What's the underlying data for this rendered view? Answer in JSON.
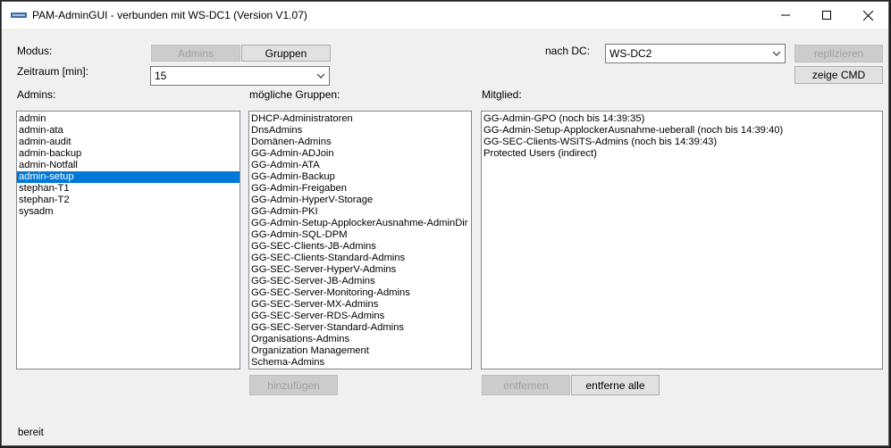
{
  "window": {
    "title": "PAM-AdminGUI - verbunden mit WS-DC1 (Version V1.07)",
    "minimize_icon": "minimize-icon",
    "maximize_icon": "maximize-icon",
    "close_icon": "close-icon"
  },
  "mode": {
    "label": "Modus:",
    "admins_button": "Admins",
    "admins_enabled": false,
    "groups_button": "Gruppen"
  },
  "timerange": {
    "label": "Zeitraum [min]:",
    "value": "15"
  },
  "dc": {
    "label": "nach DC:",
    "value": "WS-DC2",
    "replicate_button": "replizieren",
    "replicate_enabled": false,
    "show_cmd_button": "zeige CMD"
  },
  "admins": {
    "label": "Admins:",
    "items": [
      "admin",
      "admin-ata",
      "admin-audit",
      "admin-backup",
      "admin-Notfall",
      "admin-setup",
      "stephan-T1",
      "stephan-T2",
      "sysadm"
    ],
    "selected": "admin-setup"
  },
  "groups": {
    "label": "mögliche Gruppen:",
    "items": [
      "DHCP-Administratoren",
      "DnsAdmins",
      "Domänen-Admins",
      "GG-Admin-ADJoin",
      "GG-Admin-ATA",
      "GG-Admin-Backup",
      "GG-Admin-Freigaben",
      "GG-Admin-HyperV-Storage",
      "GG-Admin-PKI",
      "GG-Admin-Setup-ApplockerAusnahme-AdminDir",
      "GG-Admin-SQL-DPM",
      "GG-SEC-Clients-JB-Admins",
      "GG-SEC-Clients-Standard-Admins",
      "GG-SEC-Server-HyperV-Admins",
      "GG-SEC-Server-JB-Admins",
      "GG-SEC-Server-Monitoring-Admins",
      "GG-SEC-Server-MX-Admins",
      "GG-SEC-Server-RDS-Admins",
      "GG-SEC-Server-Standard-Admins",
      "Organisations-Admins",
      "Organization Management",
      "Schema-Admins"
    ],
    "add_button": "hinzufügen",
    "add_enabled": false
  },
  "member": {
    "label": "Mitglied:",
    "items": [
      "GG-Admin-GPO (noch bis 14:39:35)",
      "GG-Admin-Setup-ApplockerAusnahme-ueberall (noch bis 14:39:40)",
      "GG-SEC-Clients-WSITS-Admins (noch bis 14:39:43)",
      "Protected Users (indirect)"
    ],
    "remove_button": "entfernen",
    "remove_enabled": false,
    "remove_all_button": "entferne alle"
  },
  "status": {
    "text": "bereit"
  },
  "colors": {
    "selection": "#0078d7",
    "window_bg": "#f0f0f0",
    "disabled_text": "#a0a0a0"
  }
}
